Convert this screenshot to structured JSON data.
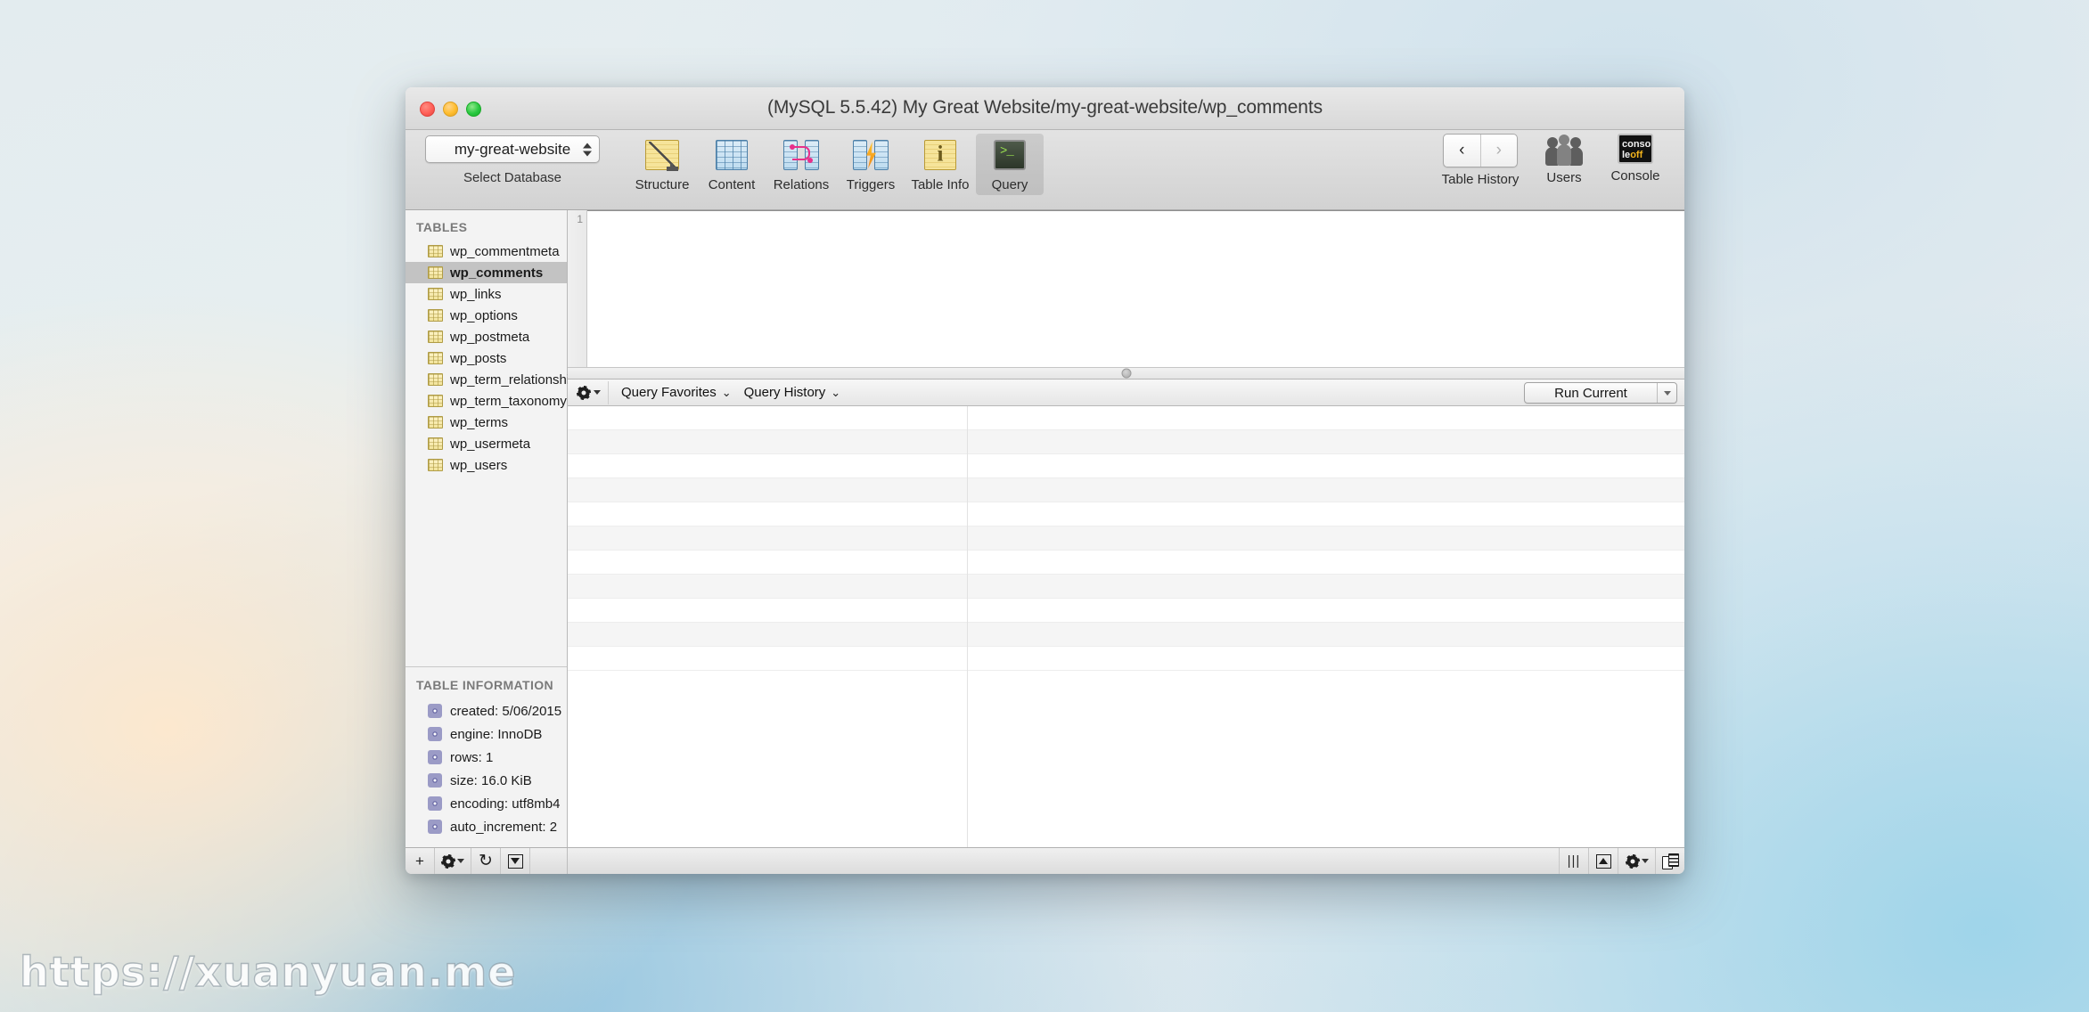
{
  "window": {
    "title": "(MySQL 5.5.42) My Great Website/my-great-website/wp_comments"
  },
  "toolbar": {
    "database": {
      "selected": "my-great-website",
      "caption": "Select Database"
    },
    "items": [
      {
        "label": "Structure",
        "icon": "structure-icon",
        "active": false
      },
      {
        "label": "Content",
        "icon": "content-grid-icon",
        "active": false
      },
      {
        "label": "Relations",
        "icon": "relations-icon",
        "active": false
      },
      {
        "label": "Triggers",
        "icon": "triggers-icon",
        "active": false
      },
      {
        "label": "Table Info",
        "icon": "table-info-icon",
        "active": false
      },
      {
        "label": "Query",
        "icon": "query-terminal-icon",
        "active": true
      }
    ],
    "right": {
      "history_label": "Table History",
      "back_glyph": "‹",
      "forward_glyph": "›",
      "users_label": "Users",
      "console_label": "Console",
      "console_icon_line1": "conso",
      "console_icon_line2": "le",
      "console_icon_off": "off"
    }
  },
  "sidebar": {
    "tables_header": "TABLES",
    "tables": [
      {
        "name": "wp_commentmeta",
        "selected": false
      },
      {
        "name": "wp_comments",
        "selected": true
      },
      {
        "name": "wp_links",
        "selected": false
      },
      {
        "name": "wp_options",
        "selected": false
      },
      {
        "name": "wp_postmeta",
        "selected": false
      },
      {
        "name": "wp_posts",
        "selected": false
      },
      {
        "name": "wp_term_relationships",
        "selected": false
      },
      {
        "name": "wp_term_taxonomy",
        "selected": false
      },
      {
        "name": "wp_terms",
        "selected": false
      },
      {
        "name": "wp_usermeta",
        "selected": false
      },
      {
        "name": "wp_users",
        "selected": false
      }
    ],
    "info_header": "TABLE INFORMATION",
    "info": [
      "created: 5/06/2015",
      "engine: InnoDB",
      "rows: 1",
      "size: 16.0 KiB",
      "encoding: utf8mb4",
      "auto_increment: 2"
    ]
  },
  "editor": {
    "line_number": "1",
    "content": ""
  },
  "query_bar": {
    "gear_label": "",
    "favorites_label": "Query Favorites",
    "history_label": "Query History",
    "chevron": "⌄",
    "run_label": "Run Current"
  },
  "results": {
    "row_count": 11
  },
  "statusbar": {
    "add_glyph": "+",
    "refresh_glyph": "↻",
    "bars_glyph": "|||",
    "left_buttons": [
      "add-row-button",
      "settings-button",
      "refresh-button",
      "filter-button"
    ],
    "right_buttons": [
      "column-resize-handle",
      "show-pane-button",
      "results-settings-button",
      "duplicate-button"
    ]
  },
  "watermark": {
    "text": "https://xuanyuan.me"
  }
}
